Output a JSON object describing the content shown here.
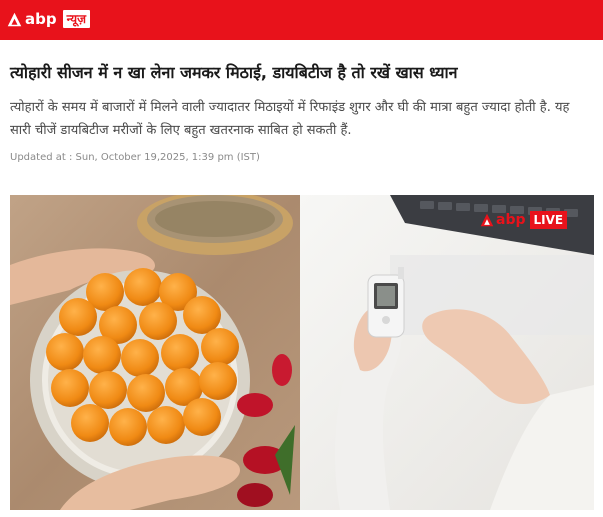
{
  "header": {
    "logo_text": "abp",
    "logo_tag": "न्यूज़",
    "brand_color": "#e8121b"
  },
  "article": {
    "headline": "त्योहारी सीजन में न खा लेना जमकर मिठाई, डायबिटीज है तो रखें खास ध्यान",
    "summary": "त्योहारों के समय में बाजारों में मिलने वाली ज्यादातर मिठाइयों में रिफाइंड शुगर और घी की मात्रा बहुत ज्यादा होती है. यह सारी चीजें डायबिटीज मरीजों के लिए बहुत खतरनाक साबित हो सकती हैं.",
    "updated": "Updated at : Sun, October 19,2025, 1:39 pm (IST)"
  },
  "hero_image": {
    "left_subject": "plate of laddoos",
    "right_subject": "glucose meter in hands",
    "watermark_logo": "abp",
    "watermark_tag": "LIVE"
  }
}
